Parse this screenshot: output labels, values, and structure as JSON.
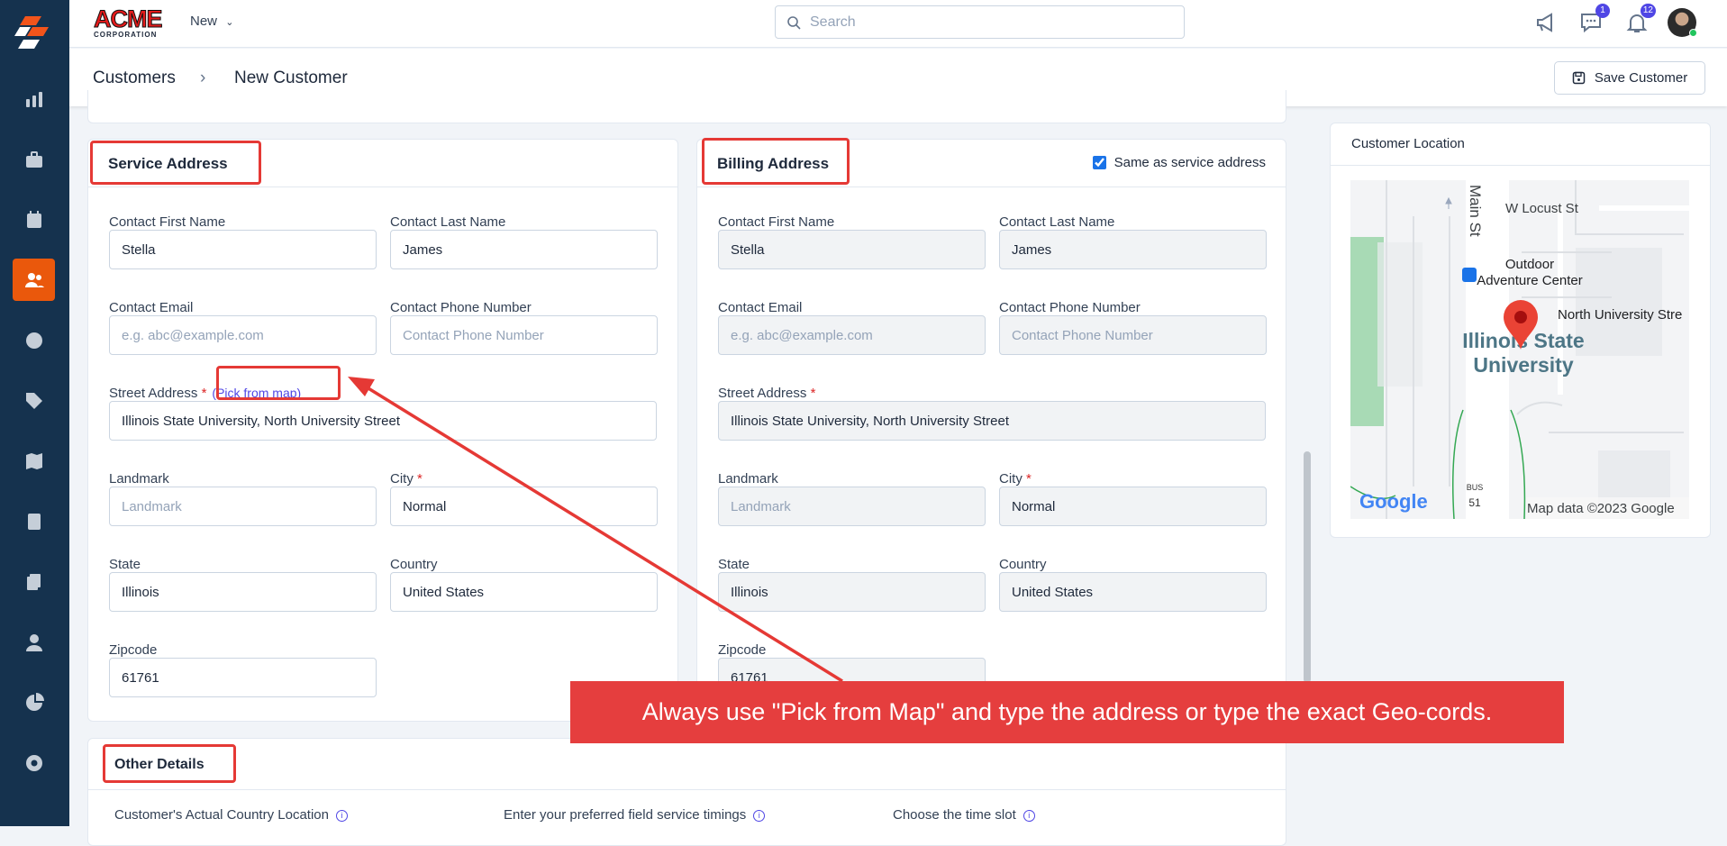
{
  "sidebar": {
    "items": [
      "analytics",
      "jobs",
      "calendar",
      "customers",
      "time",
      "tags",
      "map",
      "calculator",
      "documents",
      "users",
      "reports",
      "settings"
    ],
    "active": "customers"
  },
  "topbar": {
    "logo_text": "ACME",
    "logo_sub": "CORPORATION",
    "new_label": "New",
    "search_placeholder": "Search",
    "messages_badge": "1",
    "notifications_badge": "12"
  },
  "breadcrumb": {
    "parent": "Customers",
    "current": "New Customer"
  },
  "save_label": "Save Customer",
  "service": {
    "title": "Service Address",
    "first_name_label": "Contact First Name",
    "first_name": "Stella",
    "last_name_label": "Contact Last Name",
    "last_name": "James",
    "email_label": "Contact Email",
    "email_placeholder": "e.g. abc@example.com",
    "phone_label": "Contact Phone Number",
    "phone_placeholder": "Contact Phone Number",
    "street_label": "Street Address",
    "pick_label": "(Pick from map)",
    "street": "Illinois State University, North University Street",
    "landmark_label": "Landmark",
    "landmark_placeholder": "Landmark",
    "city_label": "City",
    "city": "Normal",
    "state_label": "State",
    "state": "Illinois",
    "country_label": "Country",
    "country": "United States",
    "zip_label": "Zipcode",
    "zip": "61761",
    "required_mark": "*"
  },
  "billing": {
    "title": "Billing Address",
    "same_label": "Same as service address",
    "same_checked": true,
    "first_name_label": "Contact First Name",
    "first_name": "Stella",
    "last_name_label": "Contact Last Name",
    "last_name": "James",
    "email_label": "Contact Email",
    "email_placeholder": "e.g. abc@example.com",
    "phone_label": "Contact Phone Number",
    "phone_placeholder": "Contact Phone Number",
    "street_label": "Street Address",
    "street": "Illinois State University, North University Street",
    "landmark_label": "Landmark",
    "landmark_placeholder": "Landmark",
    "city_label": "City",
    "city": "Normal",
    "state_label": "State",
    "state": "Illinois",
    "country_label": "Country",
    "country": "United States",
    "zip_label": "Zipcode",
    "zip": "61761"
  },
  "location": {
    "title": "Customer Location",
    "map": {
      "main_st": "Main St",
      "locust": "W Locust St",
      "poi1": "Outdoor",
      "poi2": "Adventure Center",
      "north_univ": "North University Stre",
      "campus1": "Illinois State",
      "campus2": "University",
      "bus": "BUS",
      "route": "51",
      "google": "Google",
      "attribution": "Map data ©2023 Google"
    }
  },
  "other": {
    "title": "Other Details",
    "fields": [
      "Customer's Actual Country Location",
      "Enter your preferred field service timings",
      "Choose the time slot"
    ]
  },
  "callout": "Always use \"Pick from Map\" and type the address or type the exact Geo-cords."
}
